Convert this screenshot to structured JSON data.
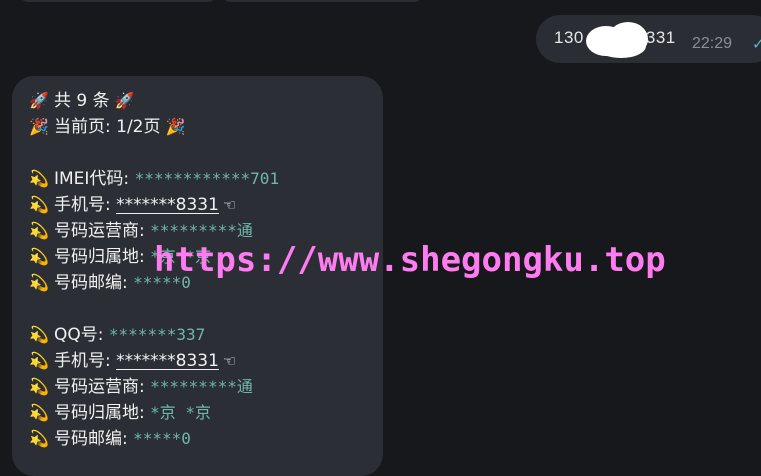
{
  "outgoing": {
    "text_start": "130",
    "text_end": "331",
    "time": "22:29",
    "check_icon": "check-icon"
  },
  "result": {
    "header_total": "共 9 条",
    "header_page": "当前页: 1/2页",
    "groups": [
      {
        "fields": [
          {
            "label": "IMEI代码:",
            "value": "************701",
            "style": "mono"
          },
          {
            "label": "手机号:",
            "value": "*******8331",
            "style": "underline",
            "hand": "☜"
          },
          {
            "label": "号码运营商:",
            "value": "*********通",
            "style": "mono"
          },
          {
            "label": "号码归属地:",
            "value": "*京 *京",
            "style": "mono"
          },
          {
            "label": "号码邮编:",
            "value": "*****0",
            "style": "mono"
          }
        ]
      },
      {
        "fields": [
          {
            "label": "QQ号:",
            "value": "*******337",
            "style": "mono"
          },
          {
            "label": "手机号:",
            "value": "*******8331",
            "style": "underline",
            "hand": "☜"
          },
          {
            "label": "号码运营商:",
            "value": "*********通",
            "style": "mono"
          },
          {
            "label": "号码归属地:",
            "value": "*京 *京",
            "style": "mono"
          },
          {
            "label": "号码邮编:",
            "value": "*****0",
            "style": "mono"
          }
        ]
      }
    ]
  },
  "watermark": "https://www.shegongku.top",
  "colors": {
    "background": "#17181c",
    "bubble": "#2b2e34",
    "mono_value": "#6fb8a5",
    "watermark": "#ff7cf0",
    "check": "#5bb6c6"
  }
}
